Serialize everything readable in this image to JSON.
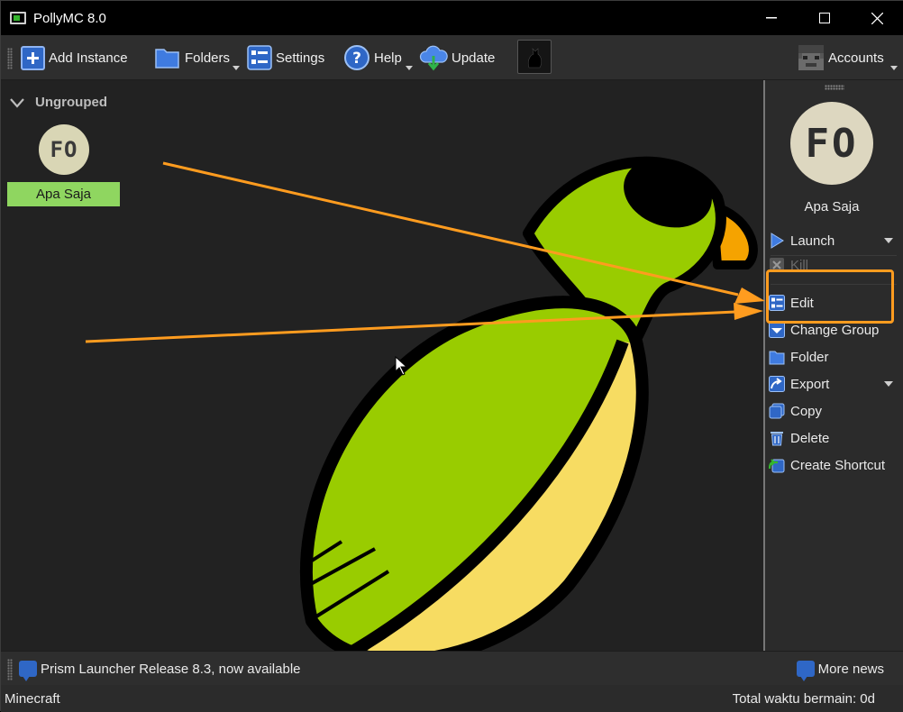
{
  "window": {
    "title": "PollyMC 8.0",
    "minimize": "—",
    "maximize": "☐",
    "close": "✕"
  },
  "toolbar": {
    "add_instance": "Add Instance",
    "folders": "Folders",
    "settings": "Settings",
    "help": "Help",
    "update": "Update",
    "accounts": "Accounts"
  },
  "instances": {
    "group_name": "Ungrouped",
    "items": [
      {
        "name": "Apa Saja",
        "icon_text": "FO"
      }
    ]
  },
  "side_panel": {
    "icon_text": "FO",
    "name": "Apa Saja",
    "actions": [
      {
        "label": "Launch",
        "icon": "play-icon"
      },
      {
        "label": "Kill",
        "icon": "kill-icon"
      },
      {
        "label": "Edit",
        "icon": "edit-icon"
      },
      {
        "label": "Change Group",
        "icon": "change-group-icon"
      },
      {
        "label": "Folder",
        "icon": "folder-icon"
      },
      {
        "label": "Export",
        "icon": "export-icon"
      },
      {
        "label": "Copy",
        "icon": "copy-icon"
      },
      {
        "label": "Delete",
        "icon": "delete-icon"
      },
      {
        "label": "Create Shortcut",
        "icon": "shortcut-icon"
      }
    ]
  },
  "news": {
    "message": "Prism Launcher Release 8.3, now available",
    "more": "More news"
  },
  "status": {
    "left": "Minecraft",
    "right": "Total waktu bermain: 0d"
  },
  "colors": {
    "accent_orange": "#ff9c1f",
    "instance_selected": "#8fd660",
    "icon_blue": "#2f67c6"
  }
}
